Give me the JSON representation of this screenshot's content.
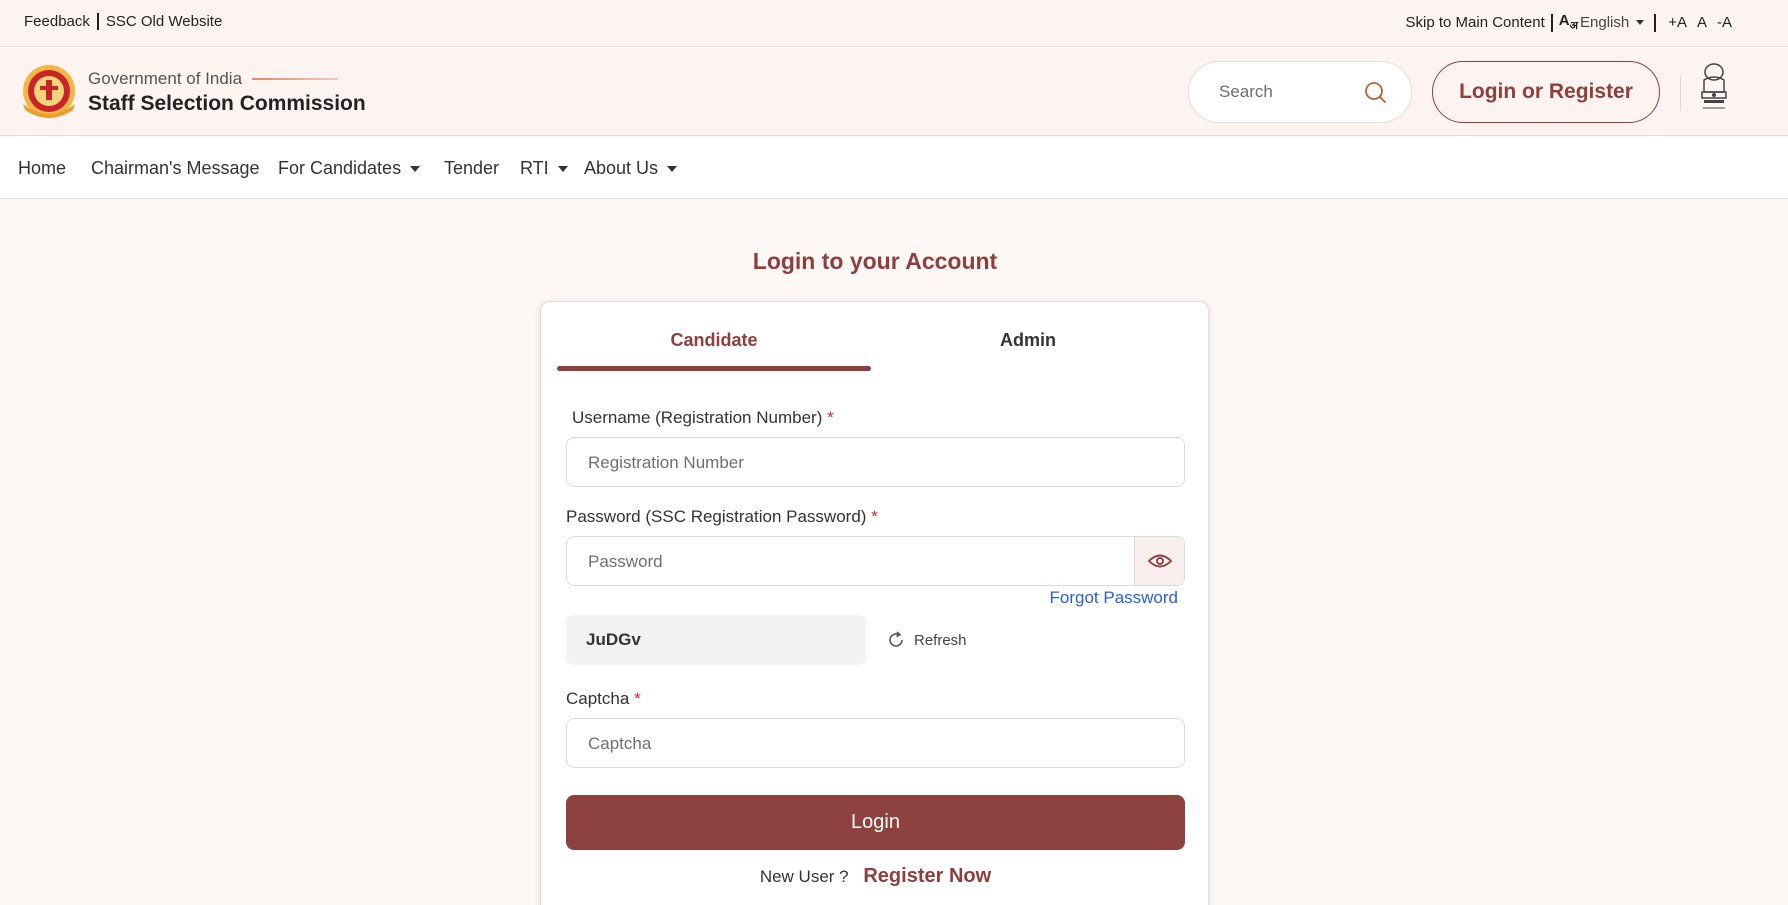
{
  "util_bar": {
    "feedback": "Feedback",
    "old_website": "SSC Old Website",
    "skip": "Skip to Main Content",
    "lang_glyph": "A",
    "lang_glyph_sub": "अ",
    "language": "English",
    "font_increase": "+A",
    "font_normal": "A",
    "font_decrease": "-A"
  },
  "header": {
    "gov": "Government of India",
    "org": "Staff Selection Commission",
    "search_placeholder": "Search",
    "login_register": "Login or Register",
    "logo_icon": "ssc-logo-icon",
    "emblem_icon": "national-emblem-icon"
  },
  "nav": {
    "items": [
      {
        "label": "Home"
      },
      {
        "label": "Chairman's Message"
      },
      {
        "label": "For Candidates"
      },
      {
        "label": "Tender"
      },
      {
        "label": "RTI"
      },
      {
        "label": "About Us"
      }
    ]
  },
  "login": {
    "title": "Login to your Account",
    "tabs": [
      "Candidate",
      "Admin"
    ],
    "username_label": "Username (Registration Number)",
    "username_placeholder": "Registration Number",
    "password_label": "Password (SSC Registration Password)",
    "password_placeholder": "Password",
    "forgot": "Forgot Password",
    "captcha_value": "JuDGv",
    "refresh": "Refresh",
    "captcha_label": "Captcha",
    "captcha_placeholder": "Captcha",
    "required_mark": "*",
    "login_button": "Login",
    "new_user": "New User ?",
    "register_now": "Register Now"
  },
  "colors": {
    "brand": "#8e3f3c",
    "link": "#2a5fd6",
    "required": "#d7262b",
    "background": "#fdf8f6"
  }
}
